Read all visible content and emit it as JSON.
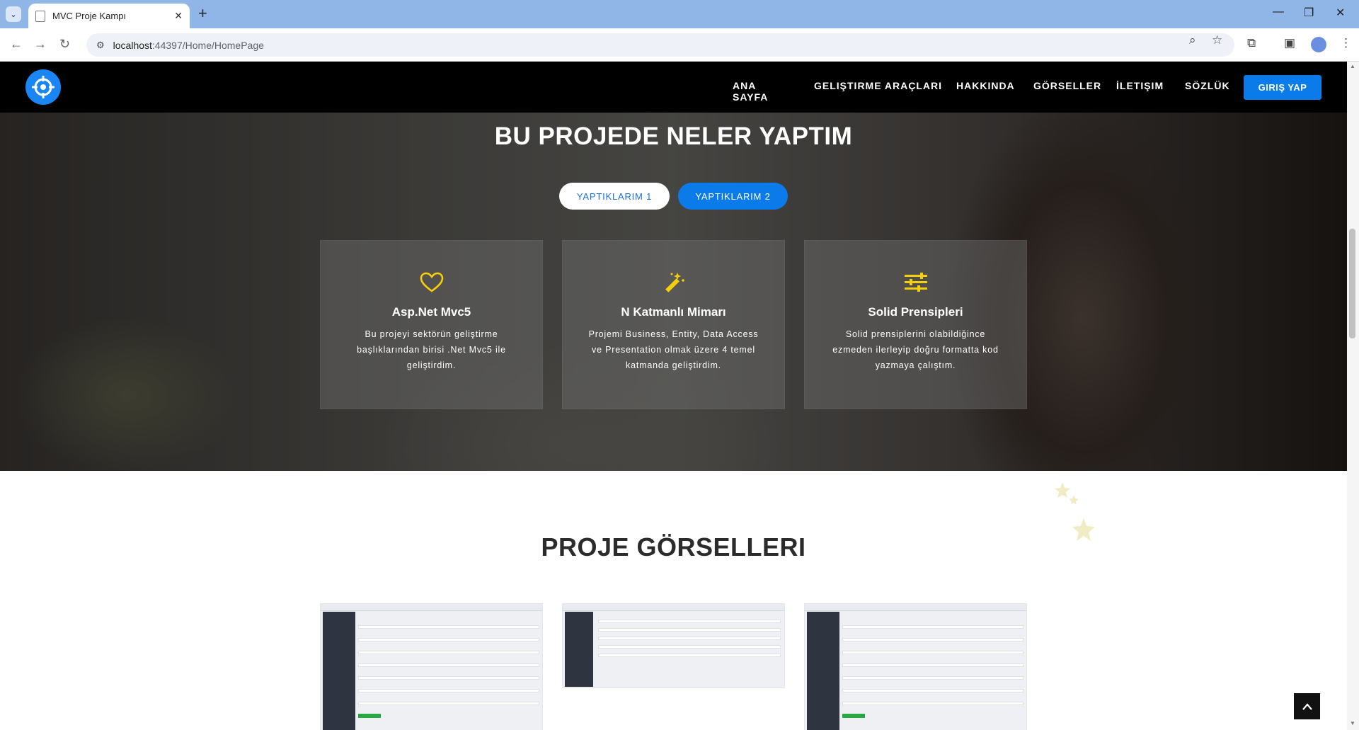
{
  "browser": {
    "tab_title": "MVC Proje Kampı",
    "url_host": "localhost",
    "url_rest": ":44397/Home/HomePage"
  },
  "site": {
    "nav": [
      "ANA SAYFA",
      "GELIŞTIRME ARAÇLARI",
      "HAKKINDA",
      "GÖRSELLER",
      "İLETIŞIM",
      "SÖZLÜK"
    ],
    "login_label": "GIRIŞ YAP"
  },
  "hero": {
    "title": "BU PROJEDE NELER YAPTIM",
    "pill1": "YAPTIKLARIM 1",
    "pill2": "YAPTIKLARIM 2",
    "accent_color": "#f5cf0a",
    "features": [
      {
        "icon": "heart-icon",
        "title": "Asp.Net Mvc5",
        "text": "Bu projeyi sektörün geliştirme başlıklarından birisi .Net Mvc5 ile geliştirdim."
      },
      {
        "icon": "magic-wand-icon",
        "title": "N Katmanlı Mimarı",
        "text": "Projemi Business, Entity, Data Access ve Presentation olmak üzere 4 temel katmanda geliştirdim."
      },
      {
        "icon": "sliders-icon",
        "title": "Solid Prensipleri",
        "text": "Solid prensiplerini olabildiğince ezmeden ilerleyip doğru formatta kod yazmaya çalıştım."
      }
    ]
  },
  "gallery": {
    "title": "PROJE GÖRSELLERI"
  }
}
